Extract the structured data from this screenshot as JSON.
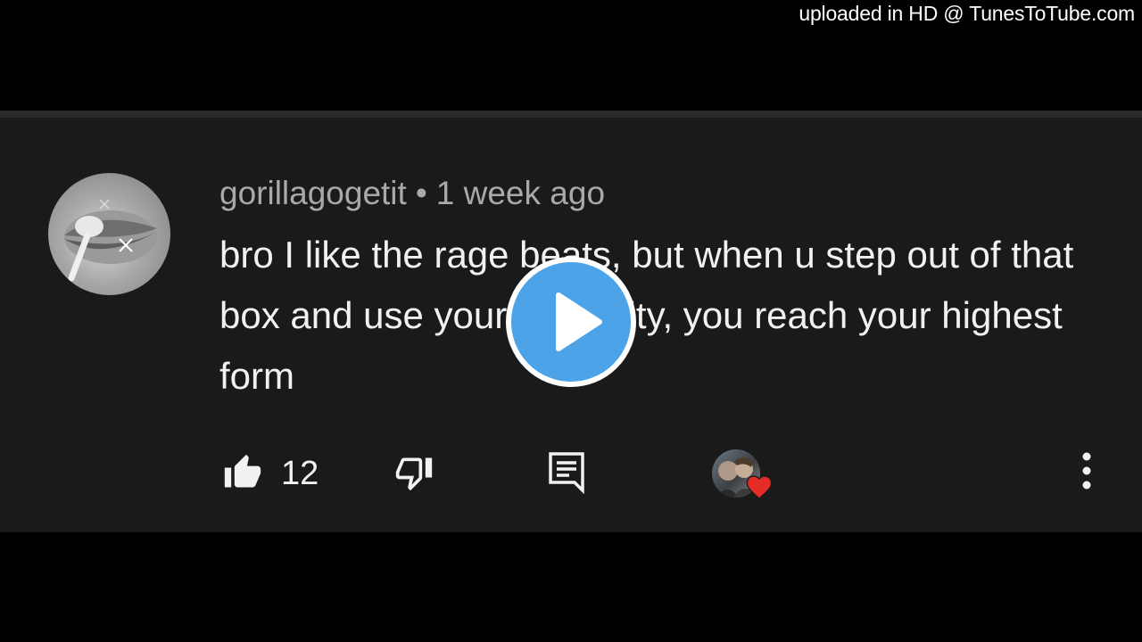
{
  "watermark": {
    "text": "uploaded in HD @ TunesToTube.com"
  },
  "comment": {
    "username": "gorillagogetit",
    "separator": "•",
    "timestamp": "1 week ago",
    "text": "bro I like the rage beats, but when u step out of that box and use your creativity, you reach your highest form",
    "avatar_icon": "avatar-image"
  },
  "actions": {
    "like_icon": "thumbs-up-icon",
    "like_count": "12",
    "dislike_icon": "thumbs-down-icon",
    "reply_icon": "reply-icon",
    "creator_heart_icon": "heart-icon",
    "more_icon": "more-vertical-icon"
  },
  "overlay": {
    "play_icon": "play-icon"
  },
  "colors": {
    "page_background": "#000000",
    "card_background": "#1a1a1a",
    "text_primary": "#f1f1f1",
    "text_secondary": "#a9a9a9",
    "play_button": "#4da3e8",
    "heart": "#e52d27"
  }
}
